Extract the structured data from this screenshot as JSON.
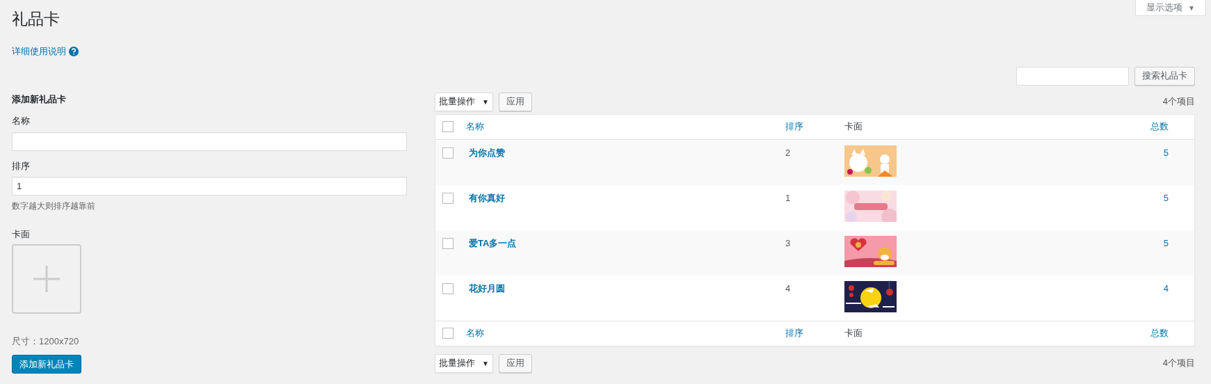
{
  "screen_options": {
    "label": "显示选项",
    "caret": "▼"
  },
  "title": "礼品卡",
  "help_link": "详细使用说明",
  "search": {
    "button": "搜索礼品卡"
  },
  "add_form": {
    "heading": "添加新礼品卡",
    "fields": [
      {
        "label": "名称"
      },
      {
        "label": "排序",
        "value": "1",
        "hint": "数字越大则排序越靠前"
      }
    ],
    "card_face_label": "卡面",
    "size_note": "尺寸：1200x720",
    "submit": "添加新礼品卡"
  },
  "bulk_top": {
    "select": "批量操作",
    "caret": "▼",
    "apply": "应用",
    "count": "4个项目"
  },
  "table": {
    "columns": [
      {
        "label": "名称",
        "kind": "link"
      },
      {
        "label": "排序",
        "kind": "link"
      },
      {
        "label": "卡面",
        "kind": "plain"
      },
      {
        "label": "总数",
        "kind": "link"
      }
    ],
    "header_checked": false,
    "rows": [
      {
        "name": "为你点赞",
        "order": "2",
        "total": "5",
        "checked": false
      },
      {
        "name": "有你真好",
        "order": "1",
        "total": "5",
        "checked": false
      },
      {
        "name": "爱TA多一点",
        "order": "3",
        "total": "5",
        "checked": false
      },
      {
        "name": "花好月圆",
        "order": "4",
        "total": "4",
        "checked": false
      }
    ],
    "footer_columns": [
      {
        "label": "名称",
        "kind": "link"
      },
      {
        "label": "排序",
        "kind": "link"
      },
      {
        "label": "卡面",
        "kind": "plain"
      },
      {
        "label": "总数",
        "kind": "link"
      }
    ],
    "footer_checked": false
  },
  "bulk_bottom": {
    "select": "批量操作",
    "caret": "▼",
    "apply": "应用",
    "count": "4个项目"
  }
}
